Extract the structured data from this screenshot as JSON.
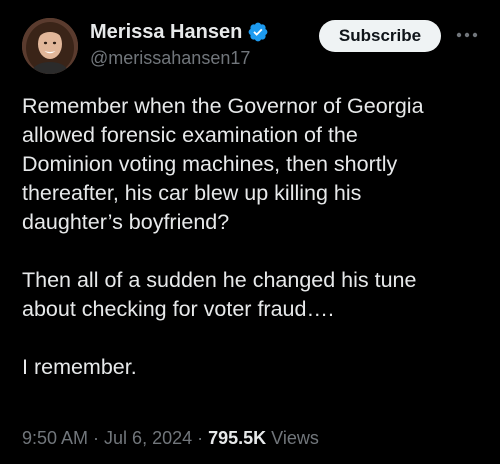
{
  "author": {
    "display_name": "Merissa Hansen",
    "handle": "@merissahansen17",
    "verified": true,
    "avatar_icon": "profile-photo"
  },
  "actions": {
    "subscribe_label": "Subscribe",
    "more_icon": "more-horizontal-icon"
  },
  "tweet": {
    "lines": [
      "Remember when the Governor of Georgia",
      "allowed forensic examination of the",
      "Dominion voting machines, then shortly",
      "thereafter, his car blew up killing his",
      "daughter’s boyfriend?",
      "",
      "Then all of a sudden he changed his tune",
      "about checking for voter fraud….",
      "",
      "I remember."
    ]
  },
  "meta": {
    "time": "9:50 AM",
    "separator": "·",
    "date": "Jul 6, 2024",
    "views_count": "795.5K",
    "views_label": "Views"
  },
  "colors": {
    "background": "#000000",
    "text": "#e7e9ea",
    "secondary": "#71767b",
    "verified_badge": "#1d9bf0",
    "button_bg": "#eff3f4"
  }
}
